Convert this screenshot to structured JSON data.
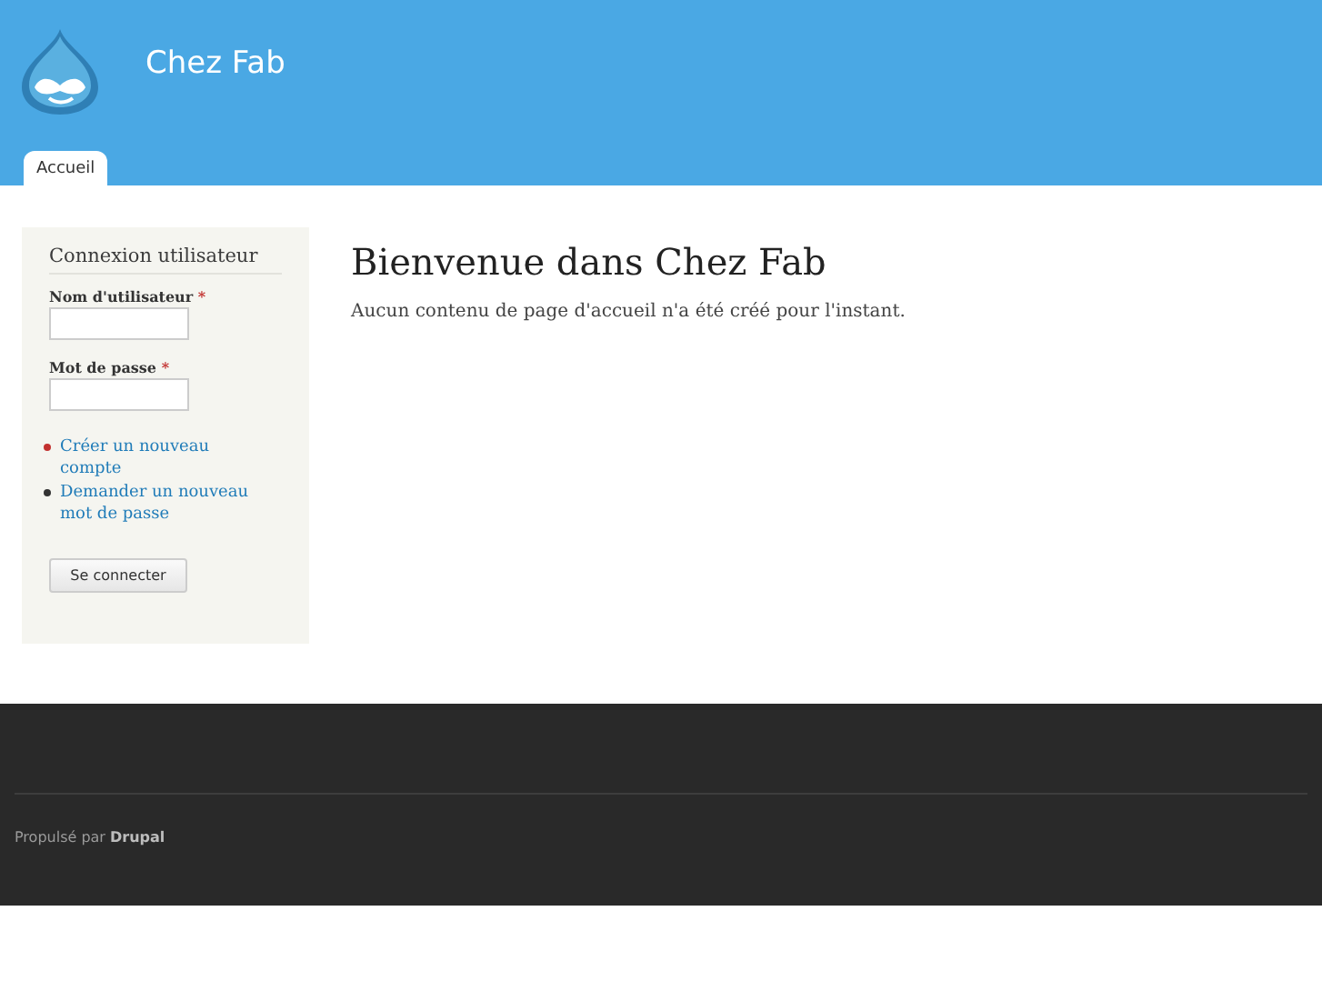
{
  "site": {
    "name": "Chez Fab"
  },
  "tabs": [
    {
      "label": "Accueil",
      "selected": true
    }
  ],
  "login_block": {
    "title": "Connexion utilisateur",
    "fields": [
      {
        "label": "Nom d'utilisateur",
        "required_mark": "*"
      },
      {
        "label": "Mot de passe",
        "required_mark": "*"
      }
    ],
    "links": [
      {
        "label": "Créer un nouveau compte",
        "color": "#c2312f"
      },
      {
        "label": "Demander un nouveau mot de passe",
        "color": "#333333"
      }
    ],
    "button": "Se connecter"
  },
  "main": {
    "title": "Bienvenue dans Chez Fab",
    "text": "Aucun contenu de page d'accueil n'a été créé pour l'instant."
  },
  "footer": {
    "text": "Propulsé par",
    "link": "Drupal"
  }
}
